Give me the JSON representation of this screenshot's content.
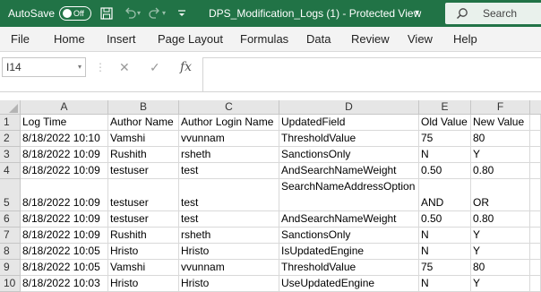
{
  "titlebar": {
    "autosave_label": "AutoSave",
    "autosave_state": "Off",
    "title": "DPS_Modification_Logs (1)  -  Protected View",
    "title_caret": "▾",
    "search_placeholder": "Search",
    "bg_color": "#217346",
    "icons": [
      "save-icon",
      "undo-icon",
      "redo-icon",
      "customize-qat-icon",
      "search-icon"
    ]
  },
  "menu": {
    "items": [
      "File",
      "Home",
      "Insert",
      "Page Layout",
      "Formulas",
      "Data",
      "Review",
      "View",
      "Help"
    ]
  },
  "formula_bar": {
    "cell_ref": "I14",
    "cancel_glyph": "✕",
    "enter_glyph": "✓",
    "fx_label": "fx",
    "content": ""
  },
  "sheet": {
    "columns": [
      "A",
      "B",
      "C",
      "D",
      "E",
      "F"
    ],
    "rows": [
      {
        "n": "1",
        "cells": [
          "Log Time",
          "Author Name",
          "Author Login Name",
          "UpdatedField",
          "Old Value",
          "New Value"
        ]
      },
      {
        "n": "2",
        "cells": [
          "8/18/2022 10:10",
          "Vamshi",
          "vvunnam",
          "ThresholdValue",
          "75",
          "80"
        ]
      },
      {
        "n": "3",
        "cells": [
          "8/18/2022 10:09",
          "Rushith",
          "rsheth",
          "SanctionsOnly",
          "N",
          "Y"
        ]
      },
      {
        "n": "4",
        "cells": [
          "8/18/2022 10:09",
          "testuser",
          "test",
          "AndSearchNameWeight",
          "0.50",
          "0.80"
        ]
      },
      {
        "n": "5",
        "cells": [
          "8/18/2022 10:09",
          "testuser",
          "test",
          "SearchNameAddressOption",
          "AND",
          "OR"
        ]
      },
      {
        "n": "6",
        "cells": [
          "8/18/2022 10:09",
          "testuser",
          "test",
          "AndSearchNameWeight",
          "0.50",
          "0.80"
        ]
      },
      {
        "n": "7",
        "cells": [
          "8/18/2022 10:09",
          "Rushith",
          "rsheth",
          "SanctionsOnly",
          "N",
          "Y"
        ]
      },
      {
        "n": "8",
        "cells": [
          "8/18/2022 10:05",
          "Hristo",
          "Hristo",
          "IsUpdatedEngine",
          "N",
          "Y"
        ]
      },
      {
        "n": "9",
        "cells": [
          "8/18/2022 10:05",
          "Vamshi",
          "vvunnam",
          "ThresholdValue",
          "75",
          "80"
        ]
      },
      {
        "n": "10",
        "cells": [
          "8/18/2022 10:03",
          "Hristo",
          "Hristo",
          "UseUpdatedEngine",
          "N",
          "Y"
        ]
      }
    ]
  }
}
